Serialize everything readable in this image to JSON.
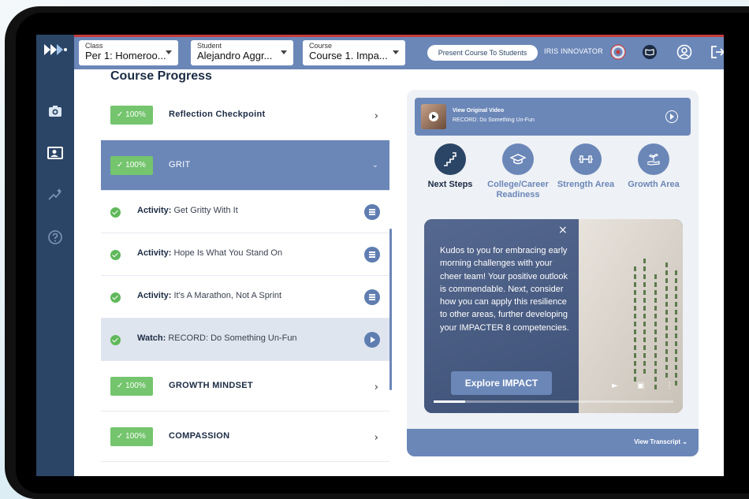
{
  "topbar": {
    "class_label": "Class",
    "class_value": "Per 1: Homeroo...",
    "student_label": "Student",
    "student_value": "Alejandro Aggr...",
    "course_label": "Course",
    "course_value": "Course 1. Impa...",
    "present_button": "Present Course To Students",
    "user_name": "IRIS INNOVATOR"
  },
  "sidebar": {
    "items": [
      {
        "icon": "camera-icon"
      },
      {
        "icon": "student-card-icon"
      },
      {
        "icon": "sparkle-icon"
      },
      {
        "icon": "help-icon"
      }
    ]
  },
  "course": {
    "title": "Course Progress",
    "sections": [
      {
        "badge": "100%",
        "title": "Reflection Checkpoint",
        "expanded": false
      },
      {
        "badge": "100%",
        "title": "GRIT",
        "expanded": true
      },
      {
        "badge": "100%",
        "title": "GROWTH MINDSET",
        "expanded": false
      },
      {
        "badge": "100%",
        "title": "COMPASSION",
        "expanded": false
      }
    ],
    "activities": [
      {
        "kind": "Activity:",
        "text": "Get Gritty With It",
        "action": "list"
      },
      {
        "kind": "Activity:",
        "text": "Hope Is What You Stand On",
        "action": "list"
      },
      {
        "kind": "Activity:",
        "text": "It's A Marathon, Not A Sprint",
        "action": "list"
      },
      {
        "kind": "Watch:",
        "text": "RECORD: Do Something Un-Fun",
        "action": "play"
      }
    ]
  },
  "video": {
    "title": "View Original Video",
    "subtitle": "RECORD: Do Something Un-Fun"
  },
  "categories": [
    {
      "label": "Next Steps",
      "active": true
    },
    {
      "label": "College/Career Readiness",
      "active": false
    },
    {
      "label": "Strength Area",
      "active": false
    },
    {
      "label": "Growth Area",
      "active": false
    }
  ],
  "feedback": {
    "close": "×",
    "text": "Kudos to you for embracing early morning challenges with your cheer team! Your positive outlook is commendable. Next, consider how you can apply this resilience to other areas, further developing your IMPACTER 8 competencies.",
    "button": "Explore IMPACT"
  },
  "transcript": {
    "label": "View Transcript ⌄"
  },
  "colors": {
    "brand_blue": "#6b87b8",
    "navy": "#2b4566",
    "success_green": "#74c56d"
  }
}
